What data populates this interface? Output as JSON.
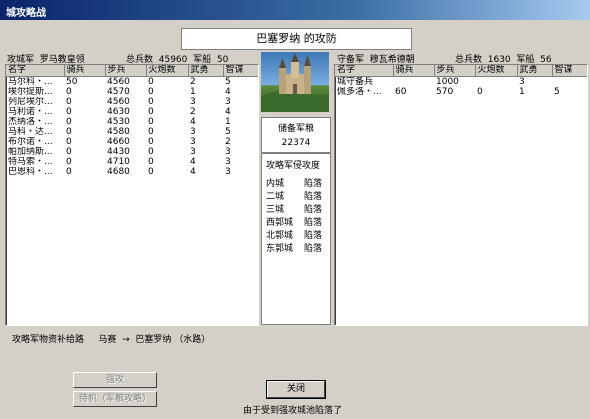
{
  "window": {
    "title": "城攻略战"
  },
  "siege_title": "巴塞罗纳 的攻防",
  "attacker": {
    "label": "攻城军",
    "leader": "罗马教皇领",
    "total_label": "总兵数",
    "total": "45960",
    "ships_label": "军船",
    "ships": "50",
    "columns": [
      "名字",
      "骑兵",
      "步兵",
      "火炮数",
      "武勇",
      "智谋"
    ],
    "rows": [
      [
        "马尔科・...",
        "50",
        "4560",
        "0",
        "2",
        "5"
      ],
      [
        "埃尔提斯...",
        "0",
        "4570",
        "0",
        "1",
        "4"
      ],
      [
        "列尼埃尔...",
        "0",
        "4560",
        "0",
        "3",
        "3"
      ],
      [
        "马利诺・...",
        "0",
        "4630",
        "0",
        "2",
        "4"
      ],
      [
        "杰纳洛・...",
        "0",
        "4530",
        "0",
        "4",
        "1"
      ],
      [
        "马科・达...",
        "0",
        "4580",
        "0",
        "3",
        "5"
      ],
      [
        "布尔诺・...",
        "0",
        "4660",
        "0",
        "3",
        "2"
      ],
      [
        "帕加纳斯...",
        "0",
        "4430",
        "0",
        "3",
        "3"
      ],
      [
        "特马索・...",
        "0",
        "4710",
        "0",
        "4",
        "3"
      ],
      [
        "巴恩科・...",
        "0",
        "4680",
        "0",
        "4",
        "3"
      ]
    ]
  },
  "defender": {
    "label": "守备军",
    "leader": "穆瓦希德朝",
    "total_label": "总兵数",
    "total": "1630",
    "ships_label": "军船",
    "ships": "56",
    "columns": [
      "名字",
      "骑兵",
      "步兵",
      "火炮数",
      "武勇",
      "智谋"
    ],
    "rows": [
      [
        "城守备兵",
        "",
        "1000",
        "",
        "3",
        ""
      ],
      [
        "佩多洛・...",
        "60",
        "570",
        "0",
        "1",
        "5"
      ]
    ]
  },
  "grain": {
    "label": "储备军粮",
    "value": "22374"
  },
  "invasion": {
    "label": "攻略军侵攻度",
    "items": [
      {
        "name": "内城",
        "state": "陷落"
      },
      {
        "name": "二城",
        "state": "陷落"
      },
      {
        "name": "三城",
        "state": "陷落"
      },
      {
        "name": "西郭城",
        "state": "陷落"
      },
      {
        "name": "北郭城",
        "state": "陷落"
      },
      {
        "name": "东郭城",
        "state": "陷落"
      }
    ]
  },
  "supply": {
    "label": "攻略军物资补给路",
    "from": "马赛",
    "arrow": "→",
    "to": "巴塞罗纳",
    "route": "（水路）"
  },
  "buttons": {
    "assault": "强攻",
    "wait": "待机（军粮攻略）",
    "close": "关闭"
  },
  "status_message": "由于受到强攻城池陷落了"
}
